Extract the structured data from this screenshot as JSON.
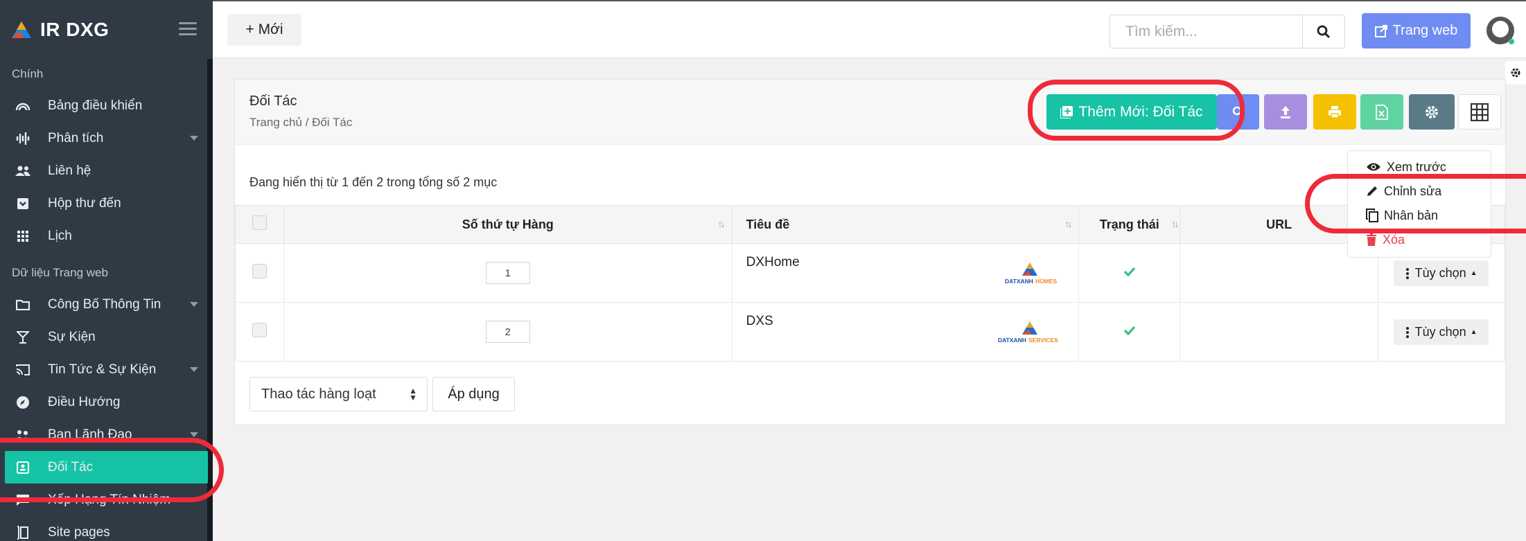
{
  "app": {
    "name": "IR DXG"
  },
  "sidebar": {
    "sections": [
      {
        "label": "Chính"
      },
      {
        "label": "Dữ liệu Trang web"
      }
    ],
    "items": [
      {
        "label": "Bảng điều khiển",
        "icon": "dashboard-gauge-icon"
      },
      {
        "label": "Phân tích",
        "icon": "analytics-waveform-icon",
        "has_submenu": true
      },
      {
        "label": "Liên hệ",
        "icon": "contacts-people-icon"
      },
      {
        "label": "Hộp thư đến",
        "icon": "inbox-icon"
      },
      {
        "label": "Lịch",
        "icon": "calendar-grid-icon"
      },
      {
        "label": "Công Bố Thông Tin",
        "icon": "folder-icon",
        "has_submenu": true
      },
      {
        "label": "Sự Kiện",
        "icon": "cocktail-glass-icon"
      },
      {
        "label": "Tin Tức & Sự Kiện",
        "icon": "cast-icon",
        "has_submenu": true
      },
      {
        "label": "Điều Hướng",
        "icon": "compass-icon"
      },
      {
        "label": "Ban Lãnh Đạo",
        "icon": "team-icon",
        "has_submenu": true
      },
      {
        "label": "Đối Tác",
        "icon": "contact-card-icon",
        "active": true
      },
      {
        "label": "Xếp Hạng Tín Nhiệm",
        "icon": "rating-chat-icon"
      },
      {
        "label": "Site pages",
        "icon": "pages-icon"
      }
    ]
  },
  "topbar": {
    "new_label": "+ Mới",
    "search_placeholder": "Tìm kiếm...",
    "website_label": "Trang web"
  },
  "page": {
    "title": "Đối Tác",
    "breadcrumb": "Trang chủ / Đối Tác",
    "add_button_label": "Thêm Mới: Đối Tác",
    "info_text": "Đang hiển thị từ 1 đến 2 trong tổng số 2 mục"
  },
  "toolbar_colors": {
    "search": "#6f8cf3",
    "upload": "#a98ee0",
    "print": "#f5c000",
    "excel": "#5fd3a0",
    "settings": "#5a7a88"
  },
  "table": {
    "columns": [
      "Số thứ tự Hàng",
      "Tiêu đề",
      "Trạng thái",
      "URL"
    ],
    "rows": [
      {
        "order": "1",
        "title": "DXHome",
        "status": "active",
        "logo_word1": "DATXANH",
        "logo_word2": "HOMES",
        "option_label": "Tùy chọn"
      },
      {
        "order": "2",
        "title": "DXS",
        "status": "active",
        "logo_word1": "DATXANH",
        "logo_word2": "SERVICES",
        "option_label": "Tùy chọn"
      }
    ]
  },
  "bulk": {
    "select_value": "Thao tác hàng loạt",
    "apply_label": "Áp dụng"
  },
  "dropdown": {
    "items": [
      {
        "label": "Xem trước",
        "icon": "eye-icon"
      },
      {
        "label": "Chỉnh sửa",
        "icon": "pencil-icon"
      },
      {
        "label": "Nhân bản",
        "icon": "copy-icon"
      },
      {
        "label": "Xóa",
        "icon": "trash-icon"
      }
    ]
  },
  "colors": {
    "accent": "#16c3a6",
    "sidebar_bg": "#2f3a45",
    "highlight": "#ef2a3a",
    "primary_blue": "#6f8cf3",
    "danger": "#e4434c"
  }
}
